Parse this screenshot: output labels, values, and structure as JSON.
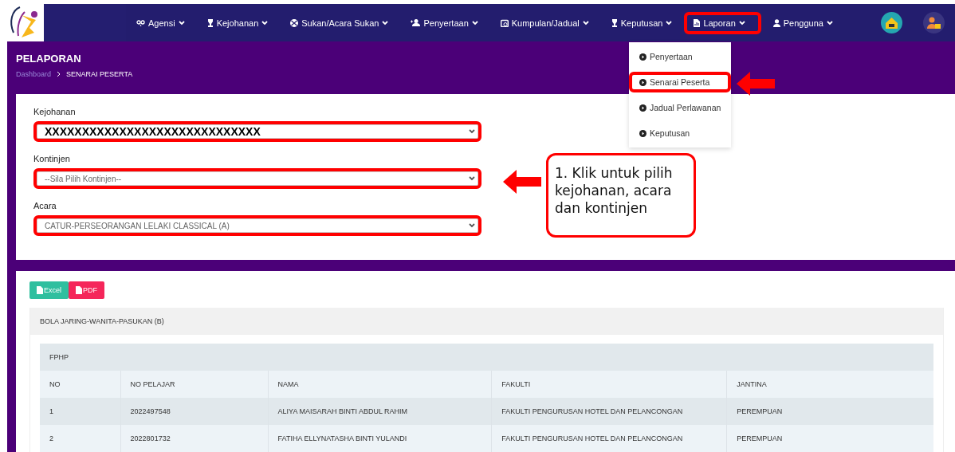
{
  "nav": {
    "items": [
      {
        "label": "Agensi",
        "highlighted": false
      },
      {
        "label": "Kejohanan",
        "highlighted": false
      },
      {
        "label": "Sukan/Acara Sukan",
        "highlighted": false
      },
      {
        "label": "Penyertaan",
        "highlighted": false
      },
      {
        "label": "Kumpulan/Jadual",
        "highlighted": false
      },
      {
        "label": "Keputusan",
        "highlighted": false
      },
      {
        "label": "Laporan",
        "highlighted": true
      },
      {
        "label": "Pengguna",
        "highlighted": false
      }
    ]
  },
  "menu": {
    "items": [
      {
        "label": "Penyertaan",
        "highlighted": false
      },
      {
        "label": "Senarai Peserta",
        "highlighted": true
      },
      {
        "label": "Jadual Perlawanan",
        "highlighted": false
      },
      {
        "label": "Keputusan",
        "highlighted": false
      }
    ]
  },
  "header": {
    "title": "PELAPORAN",
    "breadcrumb": [
      "Dashboard",
      "SENARAI PESERTA"
    ]
  },
  "form": {
    "fields": [
      {
        "label": "Kejohanan",
        "value": "XXXXXXXXXXXXXXXXXXXXXXXXXXXXX",
        "redacted": true,
        "highlighted": true
      },
      {
        "label": "Kontinjen",
        "value": "--Sila Pilih Kontinjen--",
        "redacted": false,
        "highlighted": true
      },
      {
        "label": "Acara",
        "value": "CATUR-PERSEORANGAN LELAKI CLASSICAL (A)",
        "redacted": false,
        "highlighted": true
      }
    ]
  },
  "callout": {
    "text": "1. Klik untuk pilih kejohanan, acara dan kontinjen"
  },
  "exports": [
    {
      "label": "Excel",
      "kind": "excel"
    },
    {
      "label": "PDF",
      "kind": "pdf"
    }
  ],
  "group": {
    "title": "BOLA JARING-WANITA-PASUKAN (B)",
    "table": {
      "caption": "FPHP",
      "columns": [
        "NO",
        "NO PELAJAR",
        "NAMA",
        "FAKULTI",
        "JANTINA"
      ],
      "rows": [
        [
          "1",
          "2022497548",
          "ALIYA MAISARAH BINTI ABDUL RAHIM",
          "FAKULTI PENGURUSAN HOTEL DAN PELANCONGAN",
          "PEREMPUAN"
        ],
        [
          "2",
          "2022801732",
          "FATIHA ELLYNATASHA BINTI YULANDI",
          "FAKULTI PENGURUSAN HOTEL DAN PELANCONGAN",
          "PEREMPUAN"
        ]
      ]
    }
  }
}
